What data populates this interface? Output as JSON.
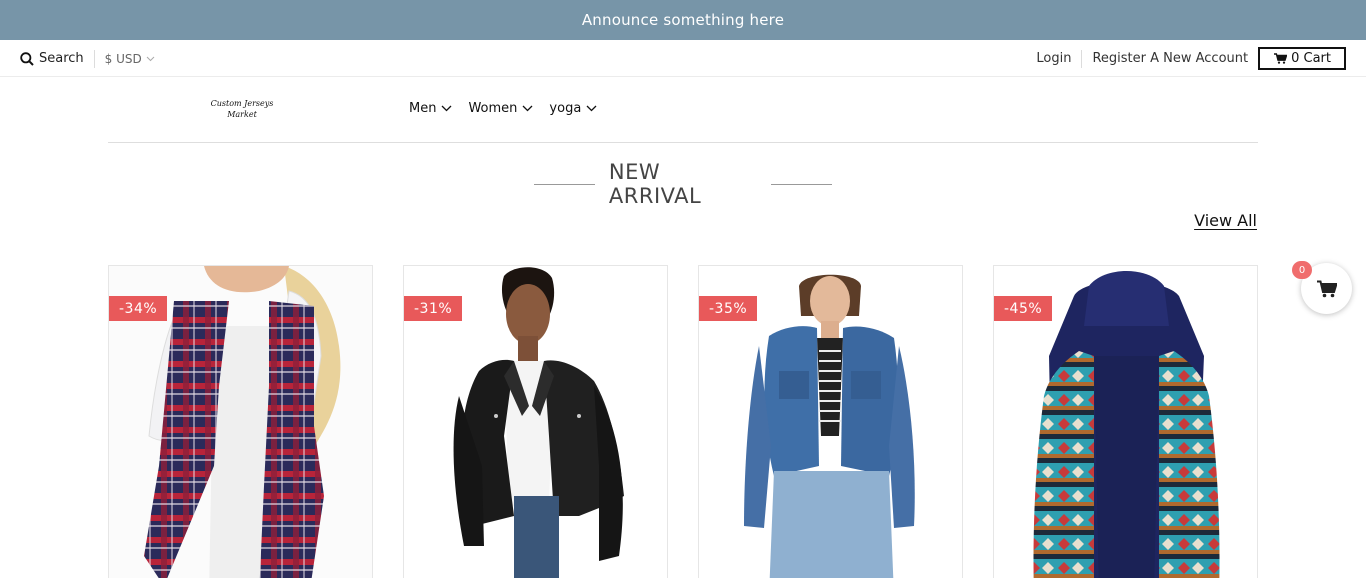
{
  "announcement": {
    "text": "Announce something here",
    "bg": "#7795a8"
  },
  "topbar": {
    "search_label": "Search",
    "currency": "$ USD",
    "login": "Login",
    "register": "Register A New Account",
    "cart_label": "0 Cart"
  },
  "logo": {
    "line1": "Custom Jerseys",
    "line2": "Market"
  },
  "nav": {
    "items": [
      {
        "label": "Men"
      },
      {
        "label": "Women"
      },
      {
        "label": "yoga"
      }
    ]
  },
  "section": {
    "title": "NEW ARRIVAL",
    "view_all": "View All"
  },
  "products": [
    {
      "discount": "-34%",
      "icon": "plaid-vest-image"
    },
    {
      "discount": "-31%",
      "icon": "leather-jacket-image"
    },
    {
      "discount": "-35%",
      "icon": "denim-jacket-image"
    },
    {
      "discount": "-45%",
      "icon": "fleece-aztec-vest-image"
    }
  ],
  "floating_cart": {
    "count": "0"
  },
  "colors": {
    "badge": "#e8595a",
    "float_count": "#f06d6d"
  }
}
